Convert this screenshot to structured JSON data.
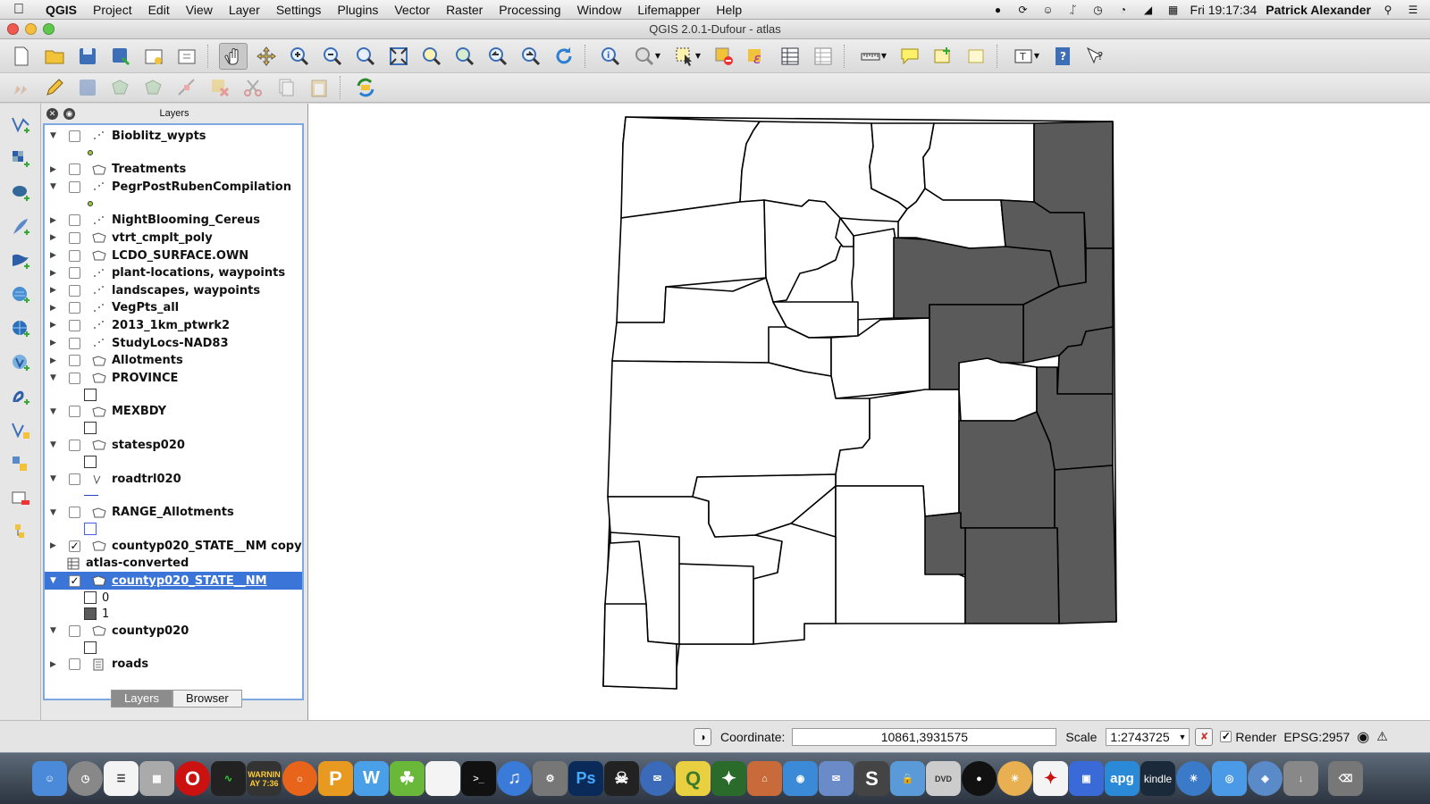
{
  "menubar": {
    "items": [
      {
        "label": "QGIS"
      },
      {
        "label": "Project"
      },
      {
        "label": "Edit"
      },
      {
        "label": "View"
      },
      {
        "label": "Layer"
      },
      {
        "label": "Settings"
      },
      {
        "label": "Plugins"
      },
      {
        "label": "Vector"
      },
      {
        "label": "Raster"
      },
      {
        "label": "Processing"
      },
      {
        "label": "Window"
      },
      {
        "label": "Lifemapper"
      },
      {
        "label": "Help"
      }
    ],
    "clock": "Fri 19:17:34",
    "user": "Patrick Alexander"
  },
  "window": {
    "title": "QGIS 2.0.1-Dufour - atlas"
  },
  "layers_panel": {
    "title": "Layers",
    "layers": [
      {
        "name": "Bioblitz_wypts",
        "expanded": true,
        "checked": false,
        "type": "point",
        "legend": [
          {
            "kind": "dot",
            "label": ""
          }
        ]
      },
      {
        "name": "Treatments",
        "expanded": false,
        "checked": false,
        "type": "polygon",
        "legend": []
      },
      {
        "name": "PegrPostRubenCompilation",
        "expanded": true,
        "checked": false,
        "type": "point",
        "legend": [
          {
            "kind": "dot",
            "label": ""
          }
        ]
      },
      {
        "name": "NightBlooming_Cereus",
        "expanded": false,
        "checked": false,
        "type": "point",
        "legend": []
      },
      {
        "name": "vtrt_cmplt_poly",
        "expanded": false,
        "checked": false,
        "type": "polygon",
        "legend": []
      },
      {
        "name": "LCDO_SURFACE.OWN",
        "expanded": false,
        "checked": false,
        "type": "polygon",
        "legend": []
      },
      {
        "name": "plant-locations, waypoints",
        "expanded": false,
        "checked": false,
        "type": "point",
        "legend": []
      },
      {
        "name": "landscapes, waypoints",
        "expanded": false,
        "checked": false,
        "type": "point",
        "legend": []
      },
      {
        "name": "VegPts_all",
        "expanded": false,
        "checked": false,
        "type": "point",
        "legend": []
      },
      {
        "name": "2013_1km_ptwrk2",
        "expanded": false,
        "checked": false,
        "type": "point",
        "legend": []
      },
      {
        "name": "StudyLocs-NAD83",
        "expanded": false,
        "checked": false,
        "type": "point",
        "legend": []
      },
      {
        "name": "Allotments",
        "expanded": false,
        "checked": false,
        "type": "polygon",
        "legend": []
      },
      {
        "name": "PROVINCE",
        "expanded": true,
        "checked": false,
        "type": "polygon",
        "legend": [
          {
            "kind": "box",
            "label": ""
          }
        ]
      },
      {
        "name": "MEXBDY",
        "expanded": true,
        "checked": false,
        "type": "polygon",
        "legend": [
          {
            "kind": "box",
            "label": ""
          }
        ]
      },
      {
        "name": "statesp020",
        "expanded": true,
        "checked": false,
        "type": "polygon",
        "legend": [
          {
            "kind": "box",
            "label": ""
          }
        ]
      },
      {
        "name": "roadtrl020",
        "expanded": true,
        "checked": false,
        "type": "line",
        "legend": [
          {
            "kind": "line",
            "label": ""
          }
        ]
      },
      {
        "name": "RANGE_Allotments",
        "expanded": true,
        "checked": false,
        "type": "polygon",
        "legend": [
          {
            "kind": "bluebox",
            "label": ""
          }
        ]
      },
      {
        "name": "countyp020_STATE__NM copy",
        "expanded": false,
        "checked": true,
        "type": "polygon",
        "legend": []
      },
      {
        "name": "atlas-converted",
        "expanded": false,
        "checked": false,
        "type": "table",
        "legend": [],
        "nocontrols": true
      },
      {
        "name": "countyp020_STATE__NM",
        "expanded": true,
        "checked": true,
        "type": "polygon",
        "selected": true,
        "legend": [
          {
            "kind": "box",
            "label": "0"
          },
          {
            "kind": "darkbox",
            "label": "1"
          }
        ]
      },
      {
        "name": "countyp020",
        "expanded": true,
        "checked": false,
        "type": "polygon",
        "legend": [
          {
            "kind": "box",
            "label": ""
          }
        ]
      },
      {
        "name": "roads",
        "expanded": false,
        "checked": false,
        "type": "raster",
        "legend": []
      }
    ],
    "tabs": [
      {
        "label": "Layers",
        "active": true
      },
      {
        "label": "Browser",
        "active": false
      }
    ]
  },
  "statusbar": {
    "coordinate_label": "Coordinate:",
    "coordinate_value": "10861,3931575",
    "scale_label": "Scale",
    "scale_value": "1:2743725",
    "render_label": "Render",
    "render_checked": true,
    "crs": "EPSG:2957"
  },
  "map": {
    "fill_selected": "#5a5a5a",
    "fill_unselected": "#ffffff",
    "stroke": "#000000"
  },
  "dock": {
    "warning_label": "WARNIN",
    "warning_time": "AY 7:36",
    "ps_label": "Ps",
    "apg_label": "apg",
    "kindle_label": "kindle"
  },
  "colors": {
    "selection": "#3c75d8",
    "panel_border": "#7ea8e0"
  }
}
